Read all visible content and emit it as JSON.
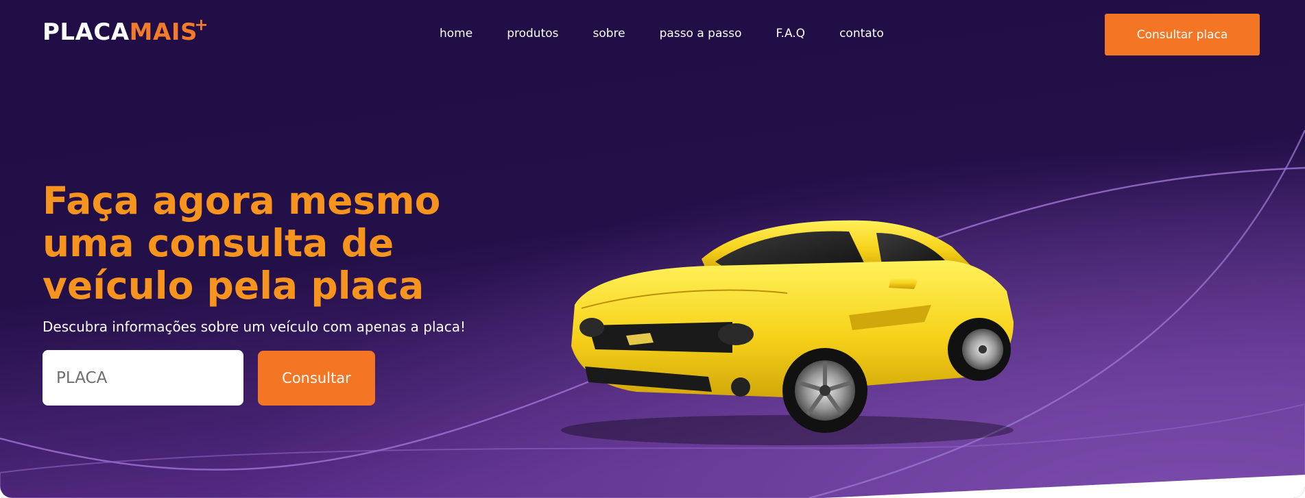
{
  "brand": {
    "logo_part1": "PLACA",
    "logo_part2": "MAIS",
    "logo_plus": "+",
    "accent_color": "#f47b2a"
  },
  "nav": {
    "items": [
      {
        "label": "home"
      },
      {
        "label": "produtos"
      },
      {
        "label": "sobre"
      },
      {
        "label": "passo a passo"
      },
      {
        "label": "F.A.Q"
      },
      {
        "label": "contato"
      }
    ]
  },
  "header": {
    "cta_label": "Consultar placa"
  },
  "hero": {
    "headline": "Faça agora mesmo uma consulta de veículo pela placa",
    "subtitle": "Descubra informações sobre um veículo com apenas a placa!",
    "plate_input": {
      "placeholder": "PLACA",
      "value": ""
    },
    "submit_label": "Consultar",
    "image": "yellow-sports-car",
    "headline_color": "#f7941d",
    "button_color": "#f47524",
    "background_colors": [
      "#200d45",
      "#7a4aa6"
    ]
  }
}
